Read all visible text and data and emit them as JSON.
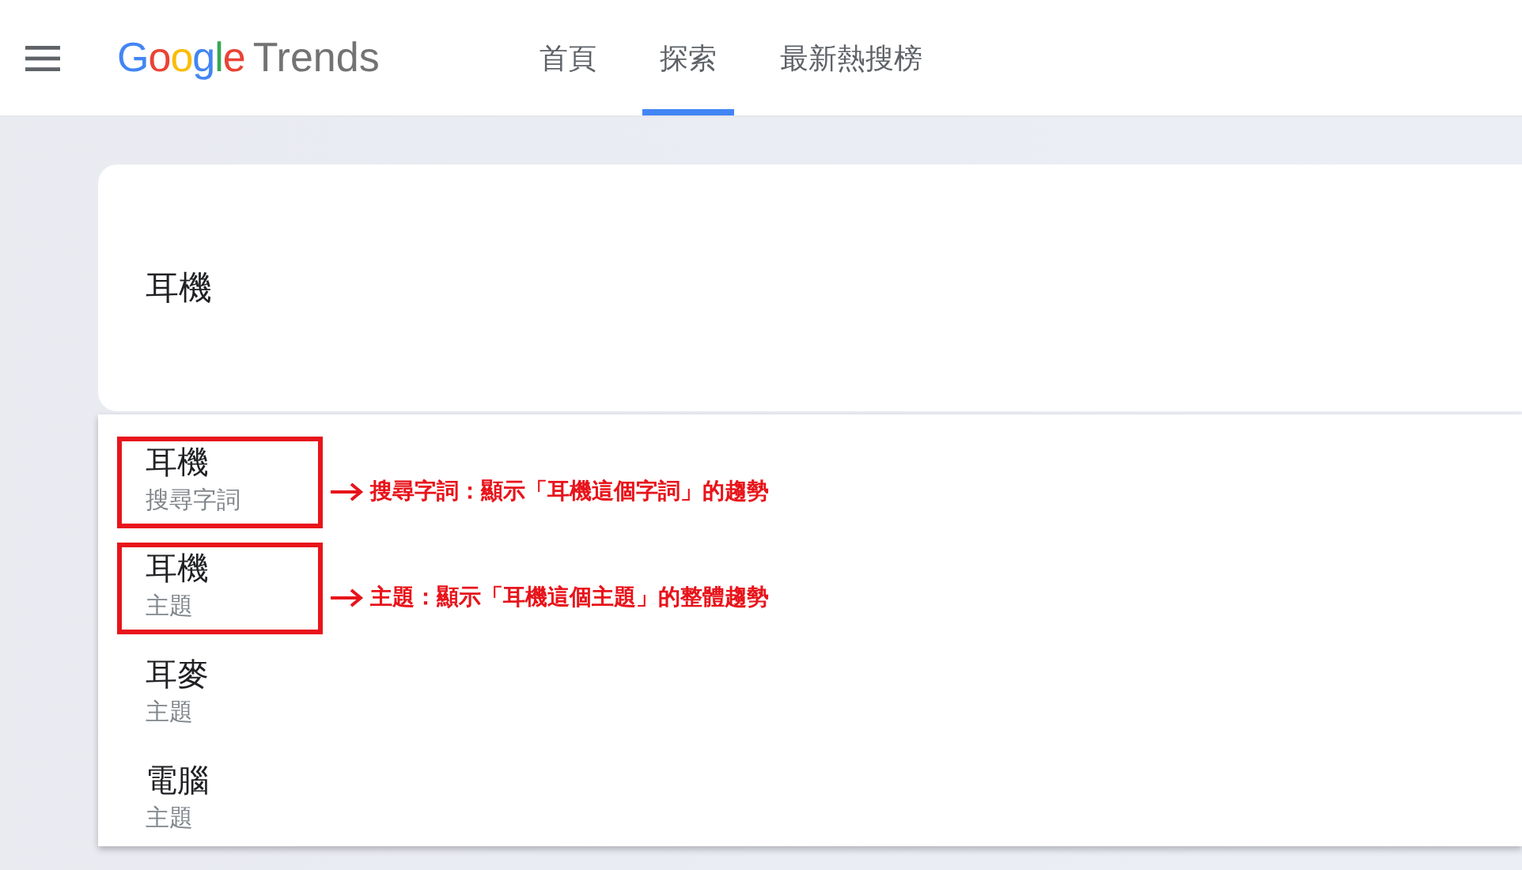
{
  "header": {
    "logo": [
      {
        "char": "G",
        "color": "#4285f4"
      },
      {
        "char": "o",
        "color": "#ea4335"
      },
      {
        "char": "o",
        "color": "#fbbc05"
      },
      {
        "char": "g",
        "color": "#4285f4"
      },
      {
        "char": "l",
        "color": "#34a853"
      },
      {
        "char": "e",
        "color": "#ea4335"
      }
    ],
    "product": "Trends",
    "tabs": [
      {
        "label": "首頁",
        "selected": false
      },
      {
        "label": "探索",
        "selected": true
      },
      {
        "label": "最新熱搜榜",
        "selected": false
      }
    ]
  },
  "search": {
    "value": "耳機"
  },
  "suggestions": [
    {
      "title": "耳機",
      "type": "搜尋字詞",
      "highlighted": true,
      "annotation": "搜尋字詞：顯示「耳機這個字詞」的趨勢"
    },
    {
      "title": "耳機",
      "type": "主題",
      "highlighted": true,
      "annotation": "主題：顯示「耳機這個主題」的整體趨勢"
    },
    {
      "title": "耳麥",
      "type": "主題",
      "highlighted": false
    },
    {
      "title": "電腦",
      "type": "主題",
      "highlighted": false
    }
  ]
}
